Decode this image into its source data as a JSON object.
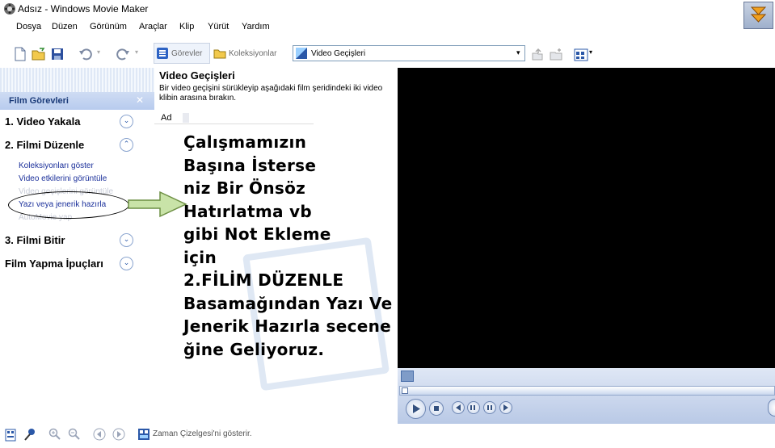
{
  "window": {
    "title": "Adsız - Windows Movie Maker"
  },
  "menu": [
    "Dosya",
    "Düzen",
    "Görünüm",
    "Araçlar",
    "Klip",
    "Yürüt",
    "Yardım"
  ],
  "toolbar": {
    "tasks_label": "Görevler",
    "collections_label": "Koleksiyonlar",
    "collection_select": "Video Geçişleri"
  },
  "left_panel": {
    "header": "Film Görevleri",
    "sections": {
      "capture": "1. Video Yakala",
      "edit": "2. Filmi Düzenle",
      "finish": "3. Filmi Bitir",
      "tips": "Film Yapma İpuçları"
    },
    "edit_tasks": {
      "show_collections": "Koleksiyonları göster",
      "view_effects": "Video etkilerini görüntüle",
      "view_transitions": "Video geçişlerini görüntüle",
      "titles_credits": "Yazı veya jenerik hazırla",
      "automovie": "AutoMovie yap"
    }
  },
  "content_pane": {
    "title": "Video Geçişleri",
    "description": "Bir video geçişini sürükleyip aşağıdaki film şeridindeki iki video klibin arasına bırakın.",
    "column_header": "Ad"
  },
  "annotation": {
    "lines": [
      "Çalışmamızın",
      "Başına İsterse",
      "niz Bir Önsöz",
      "Hatırlatma vb",
      "gibi Not Ekleme",
      "için",
      "2.FİLİM DÜZENLE",
      "Basamağından Yazı Ve",
      "Jenerik Hazırla secene",
      "ğine Geliyoruz."
    ]
  },
  "statusbar": {
    "text": "Zaman Çizelgesi'ni gösterir."
  },
  "colors": {
    "accent": "#2b58a8",
    "link": "#1a2f9a",
    "preview_bg": "#000000"
  }
}
